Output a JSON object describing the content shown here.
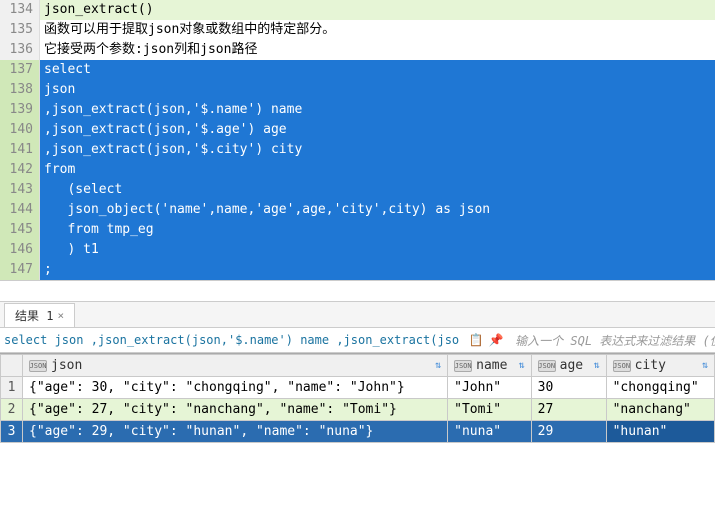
{
  "editor": {
    "lines": [
      {
        "num": 134,
        "cls": "hl",
        "text": "json_extract()"
      },
      {
        "num": 135,
        "cls": "",
        "text": "函数可以用于提取json对象或数组中的特定部分。"
      },
      {
        "num": 136,
        "cls": "",
        "text": "它接受两个参数:json列和json路径"
      },
      {
        "num": 137,
        "cls": "sel",
        "text": "select"
      },
      {
        "num": 138,
        "cls": "sel",
        "text": "json"
      },
      {
        "num": 139,
        "cls": "sel",
        "text": ",json_extract(json,'$.name') name"
      },
      {
        "num": 140,
        "cls": "sel",
        "text": ",json_extract(json,'$.age') age"
      },
      {
        "num": 141,
        "cls": "sel",
        "text": ",json_extract(json,'$.city') city"
      },
      {
        "num": 142,
        "cls": "sel",
        "text": "from"
      },
      {
        "num": 143,
        "cls": "sel",
        "text": "   (select"
      },
      {
        "num": 144,
        "cls": "sel",
        "text": "   json_object('name',name,'age',age,'city',city) as json"
      },
      {
        "num": 145,
        "cls": "sel",
        "text": "   from tmp_eg"
      },
      {
        "num": 146,
        "cls": "sel",
        "text": "   ) t1"
      },
      {
        "num": 147,
        "cls": "sel",
        "text": ";"
      }
    ]
  },
  "tabs": {
    "result_label": "结果 1"
  },
  "querybar": {
    "sql": "select json ,json_extract(json,'$.name') name ,json_extract(jso",
    "filter_placeholder": "输入一个 SQL 表达式来过滤结果 (使用"
  },
  "grid": {
    "columns": [
      "json",
      "name",
      "age",
      "city"
    ],
    "rows": [
      {
        "n": 1,
        "json": "{\"age\": 30, \"city\": \"chongqing\", \"name\": \"John\"}",
        "name": "\"John\"",
        "age": "30",
        "city": "\"chongqing\""
      },
      {
        "n": 2,
        "json": "{\"age\": 27, \"city\": \"nanchang\", \"name\": \"Tomi\"}",
        "name": "\"Tomi\"",
        "age": "27",
        "city": "\"nanchang\""
      },
      {
        "n": 3,
        "json": "{\"age\": 29, \"city\": \"hunan\", \"name\": \"nuna\"}",
        "name": "\"nuna\"",
        "age": "29",
        "city": "\"hunan\""
      }
    ],
    "json_badge": "JSON",
    "selected_row": 3,
    "selected_col": "city"
  }
}
